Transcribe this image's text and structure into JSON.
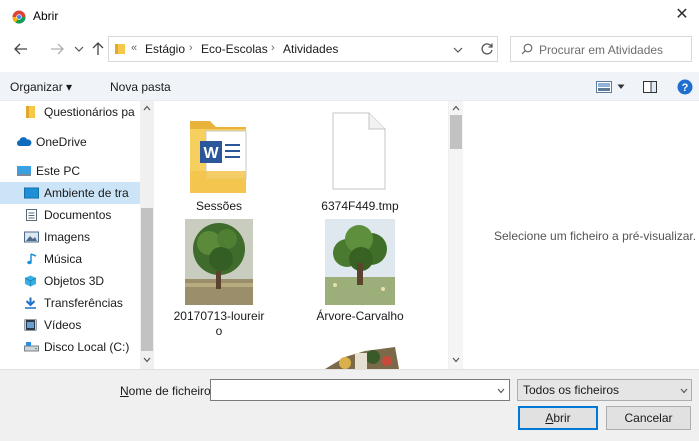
{
  "window": {
    "title": "Abrir",
    "close_glyph": "✕"
  },
  "address": {
    "overflow": "«",
    "crumbs": [
      "Estágio",
      "Eco-Escolas",
      "Atividades"
    ],
    "separator": "›",
    "search_placeholder": "Procurar em Atividades"
  },
  "toolbar": {
    "organize_label": "Organizar ▾",
    "new_folder_label": "Nova pasta"
  },
  "nav": {
    "items": [
      {
        "label": "Questionários pa",
        "icon": "folder-icon"
      },
      {
        "label": "OneDrive",
        "icon": "cloud-icon"
      },
      {
        "label": "Este PC",
        "icon": "computer-icon"
      },
      {
        "label": "Ambiente de tra",
        "icon": "desktop-icon"
      },
      {
        "label": "Documentos",
        "icon": "documents-icon"
      },
      {
        "label": "Imagens",
        "icon": "pictures-icon"
      },
      {
        "label": "Música",
        "icon": "music-icon"
      },
      {
        "label": "Objetos 3D",
        "icon": "objects-3d-icon"
      },
      {
        "label": "Transferências",
        "icon": "downloads-icon"
      },
      {
        "label": "Vídeos",
        "icon": "videos-icon"
      },
      {
        "label": "Disco Local (C:)",
        "icon": "drive-icon"
      }
    ]
  },
  "files": [
    {
      "name": "Sessões",
      "type": "folder"
    },
    {
      "name": "6374F449.tmp",
      "type": "file"
    },
    {
      "name_line1": "20170713-loureir",
      "name_line2": "o",
      "type": "image"
    },
    {
      "name": "Árvore-Carvalho",
      "type": "image"
    }
  ],
  "preview": {
    "text": "Selecione um ficheiro a pré-visualizar."
  },
  "bottom": {
    "filename_label_underline": "N",
    "filename_label_rest": "ome de ficheiro:",
    "filename_value": "",
    "filter_value": "Todos os ficheiros",
    "open_underline": "A",
    "open_rest": "brir",
    "cancel_label": "Cancelar"
  },
  "colors": {
    "accent": "#0078d7",
    "selection": "#cce4f7",
    "folder": "#f5c84c"
  }
}
